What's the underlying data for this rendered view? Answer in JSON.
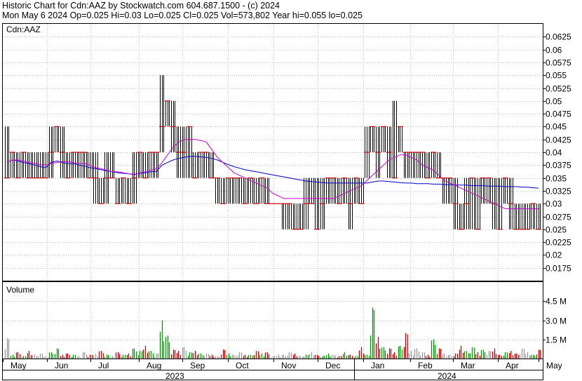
{
  "header": {
    "line1": "Historic Chart for Cdn:AAZ by Stockwatch.com 604.687.1500 - (c) 2024",
    "line2": "Mon May  6 2024  Op=0.025  Hi=0.03  Lo=0.025  Cl=0.025  Vol=573,802  Year hi=0.055  lo=0.025"
  },
  "chart_data": [
    {
      "type": "line",
      "panel": "price",
      "panel_label": "Cdn:AAZ",
      "ylim": [
        0.015,
        0.065
      ],
      "y_ticks": [
        "0.0625",
        "0.06",
        "0.0575",
        "0.055",
        "0.0525",
        "0.05",
        "0.0475",
        "0.045",
        "0.0425",
        "0.04",
        "0.0375",
        "0.035",
        "0.0325",
        "0.03",
        "0.0275",
        "0.025",
        "0.0225",
        "0.02",
        "0.0175"
      ],
      "months": [
        "May",
        "Jun",
        "Jul",
        "Aug",
        "Sep",
        "Oct",
        "Nov",
        "Dec",
        "Jan",
        "Feb",
        "Mar",
        "Apr",
        "May"
      ],
      "years": [
        "2023",
        "2024"
      ],
      "grid": true,
      "weekly_close": [
        0.035,
        0.04,
        0.035,
        0.04,
        0.035,
        0.035,
        0.035,
        0.035,
        0.04,
        0.045,
        0.04,
        0.035,
        0.04,
        0.04,
        0.04,
        0.035,
        0.035,
        0.03,
        0.035,
        0.035,
        0.03,
        0.035,
        0.03,
        0.035,
        0.04,
        0.035,
        0.04,
        0.04,
        0.045,
        0.05,
        0.045,
        0.04,
        0.04,
        0.045,
        0.035,
        0.04,
        0.04,
        0.035,
        0.035,
        0.03,
        0.035,
        0.035,
        0.035,
        0.03,
        0.035,
        0.03,
        0.035,
        0.03,
        0.03,
        0.03,
        0.03,
        0.03,
        0.025,
        0.025,
        0.03,
        0.03,
        0.025,
        0.03,
        0.035,
        0.035,
        0.03,
        0.035,
        0.03,
        0.035,
        0.03,
        0.04,
        0.045,
        0.04,
        0.045,
        0.04,
        0.035,
        0.045,
        0.04,
        0.04,
        0.04,
        0.04,
        0.035,
        0.04,
        0.035,
        0.035,
        0.035,
        0.03,
        0.025,
        0.03,
        0.035,
        0.025,
        0.035,
        0.035,
        0.03,
        0.025,
        0.035,
        0.03,
        0.025,
        0.025,
        0.025,
        0.03,
        0.025
      ],
      "weekly_high": [
        0.045,
        0.04,
        0.04,
        0.04,
        0.04,
        0.04,
        0.04,
        0.04,
        0.045,
        0.045,
        0.045,
        0.04,
        0.04,
        0.04,
        0.04,
        0.04,
        0.04,
        0.035,
        0.04,
        0.04,
        0.035,
        0.035,
        0.035,
        0.04,
        0.04,
        0.04,
        0.04,
        0.04,
        0.055,
        0.05,
        0.05,
        0.045,
        0.045,
        0.045,
        0.04,
        0.04,
        0.04,
        0.04,
        0.035,
        0.035,
        0.035,
        0.035,
        0.035,
        0.035,
        0.035,
        0.035,
        0.035,
        0.035,
        0.03,
        0.03,
        0.03,
        0.03,
        0.03,
        0.03,
        0.035,
        0.035,
        0.035,
        0.035,
        0.035,
        0.035,
        0.035,
        0.035,
        0.035,
        0.035,
        0.035,
        0.045,
        0.045,
        0.045,
        0.045,
        0.045,
        0.05,
        0.045,
        0.04,
        0.04,
        0.04,
        0.04,
        0.04,
        0.04,
        0.04,
        0.035,
        0.035,
        0.035,
        0.03,
        0.035,
        0.035,
        0.035,
        0.035,
        0.035,
        0.035,
        0.035,
        0.035,
        0.035,
        0.03,
        0.03,
        0.03,
        0.03,
        0.03
      ],
      "weekly_low": [
        0.035,
        0.035,
        0.035,
        0.035,
        0.035,
        0.035,
        0.035,
        0.035,
        0.035,
        0.04,
        0.035,
        0.035,
        0.035,
        0.035,
        0.035,
        0.035,
        0.03,
        0.03,
        0.03,
        0.035,
        0.03,
        0.03,
        0.03,
        0.03,
        0.035,
        0.035,
        0.035,
        0.035,
        0.04,
        0.045,
        0.04,
        0.035,
        0.035,
        0.035,
        0.035,
        0.035,
        0.035,
        0.035,
        0.03,
        0.03,
        0.03,
        0.03,
        0.03,
        0.03,
        0.03,
        0.03,
        0.03,
        0.03,
        0.03,
        0.03,
        0.025,
        0.025,
        0.025,
        0.025,
        0.025,
        0.03,
        0.025,
        0.025,
        0.03,
        0.03,
        0.03,
        0.03,
        0.025,
        0.03,
        0.03,
        0.035,
        0.04,
        0.035,
        0.04,
        0.035,
        0.035,
        0.04,
        0.035,
        0.035,
        0.035,
        0.035,
        0.035,
        0.035,
        0.035,
        0.03,
        0.03,
        0.025,
        0.025,
        0.025,
        0.025,
        0.025,
        0.03,
        0.03,
        0.025,
        0.025,
        0.03,
        0.025,
        0.025,
        0.025,
        0.025,
        0.025,
        0.025
      ],
      "series": [
        {
          "name": "",
          "color": "#0000cc",
          "values": [
            0.038,
            0.0385,
            0.0383,
            0.038,
            0.0378,
            0.0375,
            0.0372,
            0.037,
            0.038,
            0.0383,
            0.038,
            0.0378,
            0.0378,
            0.0375,
            0.0373,
            0.037,
            0.0368,
            0.0366,
            0.0364,
            0.0362,
            0.036,
            0.0359,
            0.0358,
            0.0357,
            0.0359,
            0.036,
            0.0362,
            0.0363,
            0.0375,
            0.038,
            0.0385,
            0.0388,
            0.039,
            0.0392,
            0.0392,
            0.0391,
            0.039,
            0.0388,
            0.0385,
            0.038,
            0.0376,
            0.0372,
            0.0369,
            0.0366,
            0.0364,
            0.0362,
            0.036,
            0.0358,
            0.0356,
            0.0354,
            0.0352,
            0.035,
            0.0348,
            0.0346,
            0.0344,
            0.0343,
            0.0342,
            0.0341,
            0.034,
            0.034,
            0.034,
            0.034,
            0.034,
            0.034,
            0.034,
            0.034,
            0.0342,
            0.0344,
            0.0344,
            0.0343,
            0.0342,
            0.0341,
            0.034,
            0.034,
            0.0339,
            0.0339,
            0.0339,
            0.0338,
            0.0338,
            0.0337,
            0.0337,
            0.0336,
            0.0336,
            0.0336,
            0.0335,
            0.0335,
            0.0335,
            0.0334,
            0.0334,
            0.0334,
            0.0333,
            0.0333,
            0.0333,
            0.0332,
            0.0332,
            0.0331,
            0.033
          ]
        },
        {
          "name": "",
          "color": "#cc00cc",
          "values": [
            0.038,
            0.0385,
            0.0385,
            0.0383,
            0.038,
            0.0378,
            0.0376,
            0.0375,
            0.0378,
            0.038,
            0.0382,
            0.0382,
            0.038,
            0.0378,
            0.0378,
            0.0375,
            0.037,
            0.0368,
            0.0365,
            0.0362,
            0.0362,
            0.036,
            0.0358,
            0.0356,
            0.036,
            0.0362,
            0.0365,
            0.0368,
            0.038,
            0.0395,
            0.041,
            0.042,
            0.0425,
            0.0425,
            0.0425,
            0.0423,
            0.042,
            0.0405,
            0.039,
            0.038,
            0.037,
            0.036,
            0.0355,
            0.035,
            0.0345,
            0.034,
            0.0335,
            0.033,
            0.032,
            0.0315,
            0.031,
            0.031,
            0.031,
            0.031,
            0.031,
            0.031,
            0.031,
            0.031,
            0.031,
            0.031,
            0.0315,
            0.032,
            0.0325,
            0.033,
            0.0335,
            0.0345,
            0.0355,
            0.0365,
            0.0375,
            0.0385,
            0.039,
            0.0395,
            0.0395,
            0.039,
            0.0385,
            0.0375,
            0.037,
            0.0365,
            0.0355,
            0.0345,
            0.034,
            0.0335,
            0.033,
            0.0325,
            0.032,
            0.0315,
            0.031,
            0.0305,
            0.03,
            0.0295,
            0.029,
            0.029,
            0.029,
            0.029,
            0.029,
            0.029,
            0.029
          ]
        }
      ]
    },
    {
      "type": "bar",
      "panel": "volume",
      "panel_label": "Volume",
      "ylim": [
        0,
        6
      ],
      "y_ticks": [
        "4.5 M",
        "3.0 M",
        "1.5 M"
      ],
      "up_color": "#009900",
      "down_color": "#cc0000",
      "flat_color": "#999999",
      "volume_millions": [
        1.6,
        0.3,
        0.5,
        0.2,
        0.6,
        0.3,
        0.4,
        0.2,
        0.5,
        0.8,
        0.3,
        0.4,
        0.3,
        0.2,
        0.5,
        0.3,
        0.4,
        0.6,
        0.3,
        0.2,
        0.5,
        0.3,
        0.4,
        0.8,
        0.6,
        1.0,
        0.6,
        0.4,
        3.0,
        1.8,
        0.7,
        0.6,
        0.9,
        0.5,
        0.6,
        0.4,
        0.4,
        0.3,
        0.2,
        0.7,
        0.4,
        0.3,
        0.5,
        0.3,
        0.3,
        0.6,
        0.4,
        0.5,
        0.2,
        0.3,
        0.3,
        0.5,
        0.4,
        0.2,
        0.3,
        0.5,
        0.3,
        0.2,
        0.4,
        0.3,
        0.2,
        0.5,
        0.3,
        0.2,
        0.9,
        0.3,
        4.0,
        1.7,
        0.9,
        0.8,
        0.5,
        1.0,
        2.0,
        0.6,
        0.8,
        0.5,
        0.3,
        1.5,
        0.8,
        0.4,
        0.3,
        0.4,
        1.0,
        0.6,
        0.9,
        0.5,
        0.7,
        0.6,
        0.8,
        0.3,
        0.5,
        0.6,
        0.4,
        0.8,
        0.5,
        0.3,
        0.7
      ],
      "vol_dir": [
        "f",
        "u",
        "d",
        "u",
        "d",
        "f",
        "f",
        "f",
        "u",
        "u",
        "d",
        "d",
        "u",
        "f",
        "f",
        "d",
        "f",
        "d",
        "u",
        "f",
        "d",
        "u",
        "d",
        "u",
        "u",
        "d",
        "u",
        "f",
        "u",
        "u",
        "d",
        "d",
        "f",
        "u",
        "d",
        "u",
        "f",
        "d",
        "f",
        "d",
        "u",
        "f",
        "f",
        "d",
        "u",
        "d",
        "u",
        "d",
        "f",
        "f",
        "f",
        "f",
        "d",
        "f",
        "u",
        "f",
        "d",
        "u",
        "u",
        "f",
        "d",
        "u",
        "d",
        "u",
        "d",
        "u",
        "u",
        "d",
        "u",
        "d",
        "d",
        "u",
        "d",
        "f",
        "f",
        "f",
        "d",
        "u",
        "d",
        "f",
        "f",
        "d",
        "d",
        "u",
        "u",
        "d",
        "u",
        "f",
        "d",
        "d",
        "u",
        "d",
        "d",
        "f",
        "f",
        "u",
        "d"
      ]
    }
  ]
}
